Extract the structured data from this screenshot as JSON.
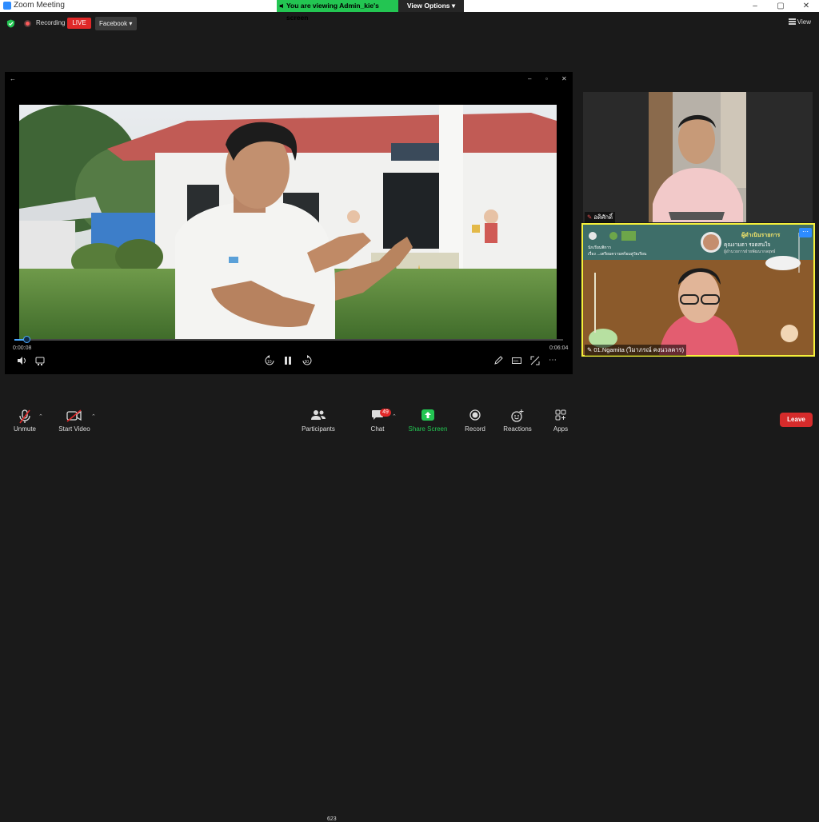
{
  "window": {
    "title": "Zoom Meeting",
    "controls": {
      "minimize": "–",
      "maximize": "▢",
      "close": "✕"
    }
  },
  "share_banner": {
    "viewing_text": "You are viewing Admin_kie's screen",
    "view_options": "View Options ▾"
  },
  "status": {
    "recording": "Recording",
    "live": "LIVE",
    "stream_target": "Facebook ▾",
    "view": "View"
  },
  "video_player": {
    "elapsed": "0:00:08",
    "duration": "0:06:04",
    "progress_fraction": 0.022
  },
  "participants": [
    {
      "name": "อดิศักดิ์"
    },
    {
      "name": "01.Ngamita (วิมาภรณ์ คงนวลคาร)"
    }
  ],
  "slide": {
    "heading": "ผู้ดำเนินรายการ",
    "presenter": "คุณงามตา รอดสนใจ",
    "role": "ผู้อำนวยการฝ่ายพัฒนากลยุทธ์",
    "left_title": "นักเรียนพิการ",
    "left_sub": "เรื่อง ...เตรียมความพร้อมสู่วัยเรียน"
  },
  "toolbar": {
    "unmute": "Unmute",
    "start_video": "Start Video",
    "participants": "Participants",
    "participants_count": "623",
    "chat": "Chat",
    "chat_badge": "49",
    "share_screen": "Share Screen",
    "record": "Record",
    "reactions": "Reactions",
    "apps": "Apps",
    "leave": "Leave"
  },
  "colors": {
    "accent_green": "#23c552",
    "live_red": "#e02828",
    "zoom_blue": "#2d8cff",
    "active_speaker": "#f5f03a"
  }
}
